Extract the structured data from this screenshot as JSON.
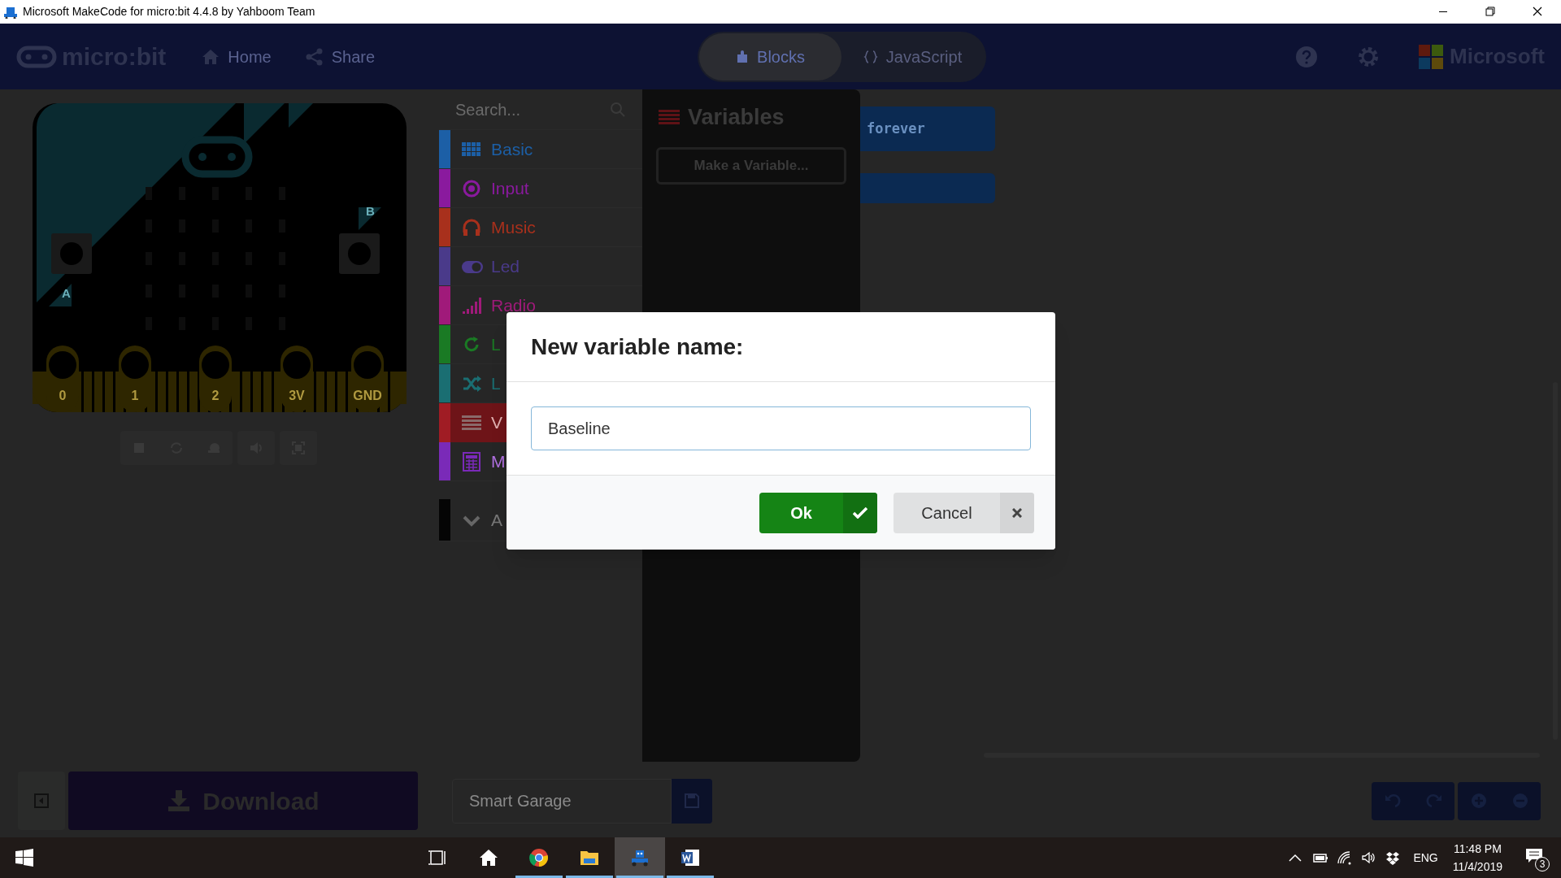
{
  "window": {
    "title": "Microsoft MakeCode for micro:bit 4.4.8 by Yahboom Team"
  },
  "menu_bar": {
    "logo": "micro:bit",
    "nav": [
      "Home",
      "Share"
    ],
    "editor_tabs": [
      {
        "label": "Blocks",
        "selected": true
      },
      {
        "label": "JavaScript",
        "selected": false
      }
    ],
    "brand": "Microsoft"
  },
  "simulator": {
    "buttons": [
      "A",
      "B"
    ],
    "pins": [
      "0",
      "1",
      "2",
      "3V",
      "GND"
    ]
  },
  "toolbox": {
    "search": {
      "placeholder": "Search..."
    },
    "categories": [
      {
        "label": "Basic",
        "kind": "grid",
        "color": "#1c5fa6",
        "selected": false
      },
      {
        "label": "Input",
        "kind": "target",
        "color": "#8a1a9e",
        "selected": false
      },
      {
        "label": "Music",
        "kind": "headphones",
        "color": "#a8301c",
        "selected": false
      },
      {
        "label": "Led",
        "kind": "toggle",
        "color": "#4a3a8a",
        "selected": false
      },
      {
        "label": "Radio",
        "kind": "signal",
        "color": "#a01a7a",
        "selected": false
      },
      {
        "label": "L",
        "kind": "loop",
        "color": "#1a7a24",
        "selected": false
      },
      {
        "label": "L",
        "kind": "shuffle",
        "color": "#1a6e72",
        "selected": false
      },
      {
        "label": "V",
        "kind": "lines",
        "color": "#a01c24",
        "selected": true
      },
      {
        "label": "M",
        "kind": "calculator",
        "color": "#7a2ab8",
        "selected": false
      },
      {
        "label": "A",
        "kind": "chevron",
        "color": "#050505",
        "selected": false
      }
    ]
  },
  "flyout": {
    "title": "Variables",
    "button": "Make a Variable..."
  },
  "workspace": {
    "block": "forever"
  },
  "bottom_bar": {
    "download": "Download",
    "project_name": "Smart Garage"
  },
  "dialog": {
    "title": "New variable name:",
    "value": "Baseline",
    "buttons": [
      {
        "label": "Ok",
        "kind": "primary"
      },
      {
        "label": "Cancel",
        "kind": "secondary"
      }
    ]
  },
  "taskbar": {
    "apps": [
      {
        "kind": "task-view",
        "running": false,
        "selected": false
      },
      {
        "kind": "home",
        "running": false,
        "selected": false
      },
      {
        "kind": "browser",
        "running": true,
        "selected": false
      },
      {
        "kind": "folder",
        "running": true,
        "selected": false
      },
      {
        "kind": "robot",
        "running": true,
        "selected": true
      },
      {
        "kind": "word",
        "running": true,
        "selected": false
      }
    ],
    "language": "ENG",
    "time": "11:48 PM",
    "date": "11/4/2019",
    "notifications": "3"
  }
}
